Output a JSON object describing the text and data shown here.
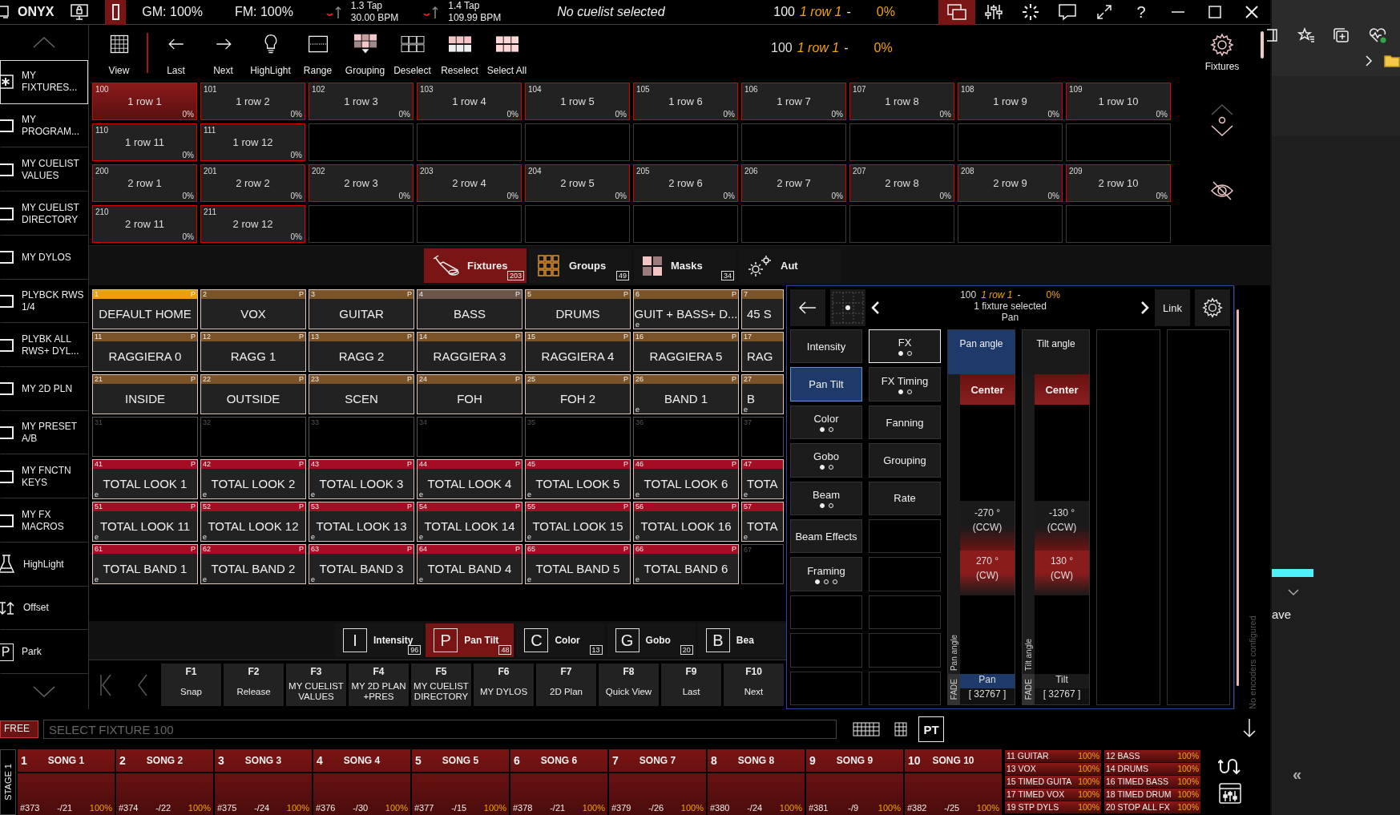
{
  "topbar": {
    "brand": "ONYX",
    "gm": "GM: 100%",
    "fm": "FM: 100%",
    "taps": [
      {
        "label": "1.3 Tap",
        "bpm": "30.00 BPM"
      },
      {
        "label": "1.4 Tap",
        "bpm": "109.99 BPM"
      }
    ],
    "cuelist": "No cuelist selected",
    "status": {
      "number": "100",
      "name": "1 row 1",
      "dash": "-",
      "percent": "0%"
    },
    "tools": [
      {
        "kind": "windows",
        "selected": true
      },
      {
        "kind": "faders",
        "selected": false
      },
      {
        "kind": "spinner",
        "selected": false
      },
      {
        "kind": "chat",
        "selected": false
      },
      {
        "kind": "expand",
        "selected": false
      }
    ],
    "help": "?"
  },
  "sidebar": [
    {
      "kind": "star",
      "label": "MY FIXTURES...",
      "selected": true
    },
    {
      "kind": "page",
      "label": "MY PROGRAM...",
      "selected": false
    },
    {
      "kind": "page",
      "label": "MY CUELIST VALUES",
      "selected": false
    },
    {
      "kind": "page",
      "label": "MY CUELIST DIRECTORY",
      "selected": false
    },
    {
      "kind": "page",
      "label": "MY DYLOS",
      "selected": false
    },
    {
      "kind": "page",
      "label": "PLYBCK RWS 1/4",
      "selected": false
    },
    {
      "kind": "page",
      "label": "PLYBK ALL RWS+ DYL...",
      "selected": false
    },
    {
      "kind": "page",
      "label": "MY 2D PLN",
      "selected": false
    },
    {
      "kind": "page",
      "label": "MY PRESET A/B",
      "selected": false
    },
    {
      "kind": "page",
      "label": "MY FNCTN KEYS",
      "selected": false
    },
    {
      "kind": "page",
      "label": "MY FX MACROS",
      "selected": false
    },
    {
      "kind": "highlight",
      "label": "HighLight",
      "selected": false
    },
    {
      "kind": "offset",
      "label": "Offset",
      "selected": false
    },
    {
      "kind": "park",
      "letter": "P",
      "label": "Park",
      "selected": false
    }
  ],
  "toolbar": [
    {
      "kind": "view",
      "label": "View"
    },
    {
      "kind": "last",
      "label": "Last"
    },
    {
      "kind": "next",
      "label": "Next"
    },
    {
      "kind": "highlight",
      "label": "HighLight"
    },
    {
      "kind": "range",
      "label": "Range"
    },
    {
      "kind": "grouping",
      "label": "Grouping"
    },
    {
      "kind": "deselect",
      "label": "Deselect"
    },
    {
      "kind": "reselect",
      "label": "Reselect"
    },
    {
      "kind": "select_all",
      "label": "Select All"
    }
  ],
  "selection_status": {
    "number": "100",
    "name": "1 row 1",
    "dash": "-",
    "percent": "0%"
  },
  "fixtures_panel": {
    "label": "Fixtures"
  },
  "fixtures": [
    {
      "kind": "fixture",
      "number": "100",
      "name": "1 row 1",
      "percent": "0%",
      "selected": true
    },
    {
      "kind": "fixture",
      "number": "101",
      "name": "1 row 2",
      "percent": "0%",
      "selected": false
    },
    {
      "kind": "fixture",
      "number": "102",
      "name": "1 row 3",
      "percent": "0%",
      "selected": false
    },
    {
      "kind": "fixture",
      "number": "103",
      "name": "1 row 4",
      "percent": "0%",
      "selected": false
    },
    {
      "kind": "fixture",
      "number": "104",
      "name": "1 row 5",
      "percent": "0%",
      "selected": false
    },
    {
      "kind": "fixture",
      "number": "105",
      "name": "1 row 6",
      "percent": "0%",
      "selected": false
    },
    {
      "kind": "fixture",
      "number": "106",
      "name": "1 row 7",
      "percent": "0%",
      "selected": false
    },
    {
      "kind": "fixture",
      "number": "107",
      "name": "1 row 8",
      "percent": "0%",
      "selected": false
    },
    {
      "kind": "fixture",
      "number": "108",
      "name": "1 row 9",
      "percent": "0%",
      "selected": false
    },
    {
      "kind": "fixture",
      "number": "109",
      "name": "1 row 10",
      "percent": "0%",
      "selected": false
    },
    {
      "kind": "fixture",
      "number": "110",
      "name": "1 row 11",
      "percent": "0%",
      "selected": false
    },
    {
      "kind": "fixture",
      "number": "111",
      "name": "1 row 12",
      "percent": "0%",
      "selected": false
    },
    {
      "kind": "empty"
    },
    {
      "kind": "empty"
    },
    {
      "kind": "empty"
    },
    {
      "kind": "empty"
    },
    {
      "kind": "empty"
    },
    {
      "kind": "empty"
    },
    {
      "kind": "empty"
    },
    {
      "kind": "empty"
    },
    {
      "kind": "fixture",
      "number": "200",
      "name": "2 row 1",
      "percent": "0%",
      "selected": false
    },
    {
      "kind": "fixture",
      "number": "201",
      "name": "2 row 2",
      "percent": "0%",
      "selected": false
    },
    {
      "kind": "fixture",
      "number": "202",
      "name": "2 row 3",
      "percent": "0%",
      "selected": false
    },
    {
      "kind": "fixture",
      "number": "203",
      "name": "2 row 4",
      "percent": "0%",
      "selected": false
    },
    {
      "kind": "fixture",
      "number": "204",
      "name": "2 row 5",
      "percent": "0%",
      "selected": false
    },
    {
      "kind": "fixture",
      "number": "205",
      "name": "2 row 6",
      "percent": "0%",
      "selected": false
    },
    {
      "kind": "fixture",
      "number": "206",
      "name": "2 row 7",
      "percent": "0%",
      "selected": false
    },
    {
      "kind": "fixture",
      "number": "207",
      "name": "2 row 8",
      "percent": "0%",
      "selected": false
    },
    {
      "kind": "fixture",
      "number": "208",
      "name": "2 row 9",
      "percent": "0%",
      "selected": false
    },
    {
      "kind": "fixture",
      "number": "209",
      "name": "2 row 10",
      "percent": "0%",
      "selected": false
    },
    {
      "kind": "fixture",
      "number": "210",
      "name": "2 row 11",
      "percent": "0%",
      "selected": false
    },
    {
      "kind": "fixture",
      "number": "211",
      "name": "2 row 12",
      "percent": "0%",
      "selected": false
    },
    {
      "kind": "empty"
    },
    {
      "kind": "empty"
    },
    {
      "kind": "empty"
    },
    {
      "kind": "empty"
    },
    {
      "kind": "empty"
    },
    {
      "kind": "empty"
    },
    {
      "kind": "empty"
    },
    {
      "kind": "empty"
    }
  ],
  "tabs": [
    {
      "kind": "fixtures",
      "label": "Fixtures",
      "count": "203",
      "selected": true
    },
    {
      "kind": "groups",
      "label": "Groups",
      "count": "49",
      "selected": false
    },
    {
      "kind": "masks",
      "label": "Masks",
      "count": "34",
      "selected": false
    },
    {
      "kind": "auto",
      "label": "Aut",
      "selected": false
    }
  ],
  "presets": [
    {
      "kind": "preset",
      "number": "1",
      "name": "DEFAULT HOME",
      "color": "#e8a010",
      "tag": "P"
    },
    {
      "kind": "preset",
      "number": "2",
      "name": "VOX",
      "color": "#7a5428",
      "tag": "P"
    },
    {
      "kind": "preset",
      "number": "3",
      "name": "GUITAR",
      "color": "#7a5428",
      "tag": "P"
    },
    {
      "kind": "preset",
      "number": "4",
      "name": "BASS",
      "color": "#6b5548",
      "tag": "P"
    },
    {
      "kind": "preset",
      "number": "5",
      "name": "DRUMS",
      "color": "#7a5428",
      "tag": "P"
    },
    {
      "kind": "preset",
      "number": "6",
      "name": "GUIT + BASS+ D...",
      "color": "#7a5428",
      "tag": "P",
      "flag": "e"
    },
    {
      "kind": "preset",
      "number": "7",
      "name": "45 S",
      "color": "#7a5428"
    },
    {
      "kind": "preset",
      "number": "11",
      "name": "RAGGIERA 0",
      "color": "#7a5428",
      "tag": "P"
    },
    {
      "kind": "preset",
      "number": "12",
      "name": "RAGG 1",
      "color": "#7a5428",
      "tag": "P"
    },
    {
      "kind": "preset",
      "number": "13",
      "name": "RAGG 2",
      "color": "#7a5428",
      "tag": "P"
    },
    {
      "kind": "preset",
      "number": "14",
      "name": "RAGGIERA 3",
      "color": "#7a5428",
      "tag": "P"
    },
    {
      "kind": "preset",
      "number": "15",
      "name": "RAGGIERA 4",
      "color": "#7a5428",
      "tag": "P"
    },
    {
      "kind": "preset",
      "number": "16",
      "name": "RAGGIERA 5",
      "color": "#7a5428",
      "tag": "P"
    },
    {
      "kind": "preset",
      "number": "17",
      "name": "RAG",
      "color": "#7a5428"
    },
    {
      "kind": "preset",
      "number": "21",
      "name": "INSIDE",
      "color": "#7a5428",
      "tag": "P"
    },
    {
      "kind": "preset",
      "number": "22",
      "name": "OUTSIDE",
      "color": "#7a5428",
      "tag": "P"
    },
    {
      "kind": "preset",
      "number": "23",
      "name": "SCEN",
      "color": "#7a5428",
      "tag": "P"
    },
    {
      "kind": "preset",
      "number": "24",
      "name": "FOH",
      "color": "#7a5428",
      "tag": "P"
    },
    {
      "kind": "preset",
      "number": "25",
      "name": "FOH 2",
      "color": "#7a5428",
      "tag": "P"
    },
    {
      "kind": "preset",
      "number": "26",
      "name": "BAND 1",
      "color": "#7a5428",
      "tag": "P",
      "flag": "e"
    },
    {
      "kind": "preset",
      "number": "27",
      "name": "B",
      "color": "#7a5428",
      "flag": "e"
    },
    {
      "kind": "empty",
      "number": "31"
    },
    {
      "kind": "empty",
      "number": "32"
    },
    {
      "kind": "empty",
      "number": "33"
    },
    {
      "kind": "empty",
      "number": "34"
    },
    {
      "kind": "empty",
      "number": "35"
    },
    {
      "kind": "empty",
      "number": "36"
    },
    {
      "kind": "empty",
      "number": "37"
    },
    {
      "kind": "preset",
      "number": "41",
      "name": "TOTAL LOOK 1",
      "color": "#a50d25",
      "tag": "P",
      "flag": "e"
    },
    {
      "kind": "preset",
      "number": "42",
      "name": "TOTAL LOOK 2",
      "color": "#a50d25",
      "tag": "P",
      "flag": "e"
    },
    {
      "kind": "preset",
      "number": "43",
      "name": "TOTAL LOOK 3",
      "color": "#a50d25",
      "tag": "P",
      "flag": "e"
    },
    {
      "kind": "preset",
      "number": "44",
      "name": "TOTAL LOOK 4",
      "color": "#a50d25",
      "tag": "P",
      "flag": "e"
    },
    {
      "kind": "preset",
      "number": "45",
      "name": "TOTAL LOOK 5",
      "color": "#a50d25",
      "tag": "P",
      "flag": "e"
    },
    {
      "kind": "preset",
      "number": "46",
      "name": "TOTAL LOOK 6",
      "color": "#a50d25",
      "tag": "P",
      "flag": "e"
    },
    {
      "kind": "preset",
      "number": "47",
      "name": "TOTA",
      "color": "#a50d25",
      "flag": "e"
    },
    {
      "kind": "preset",
      "number": "51",
      "name": "TOTAL LOOK 11",
      "color": "#a50d25",
      "tag": "P",
      "flag": "e"
    },
    {
      "kind": "preset",
      "number": "52",
      "name": "TOTAL LOOK 12",
      "color": "#a50d25",
      "tag": "P",
      "flag": "e"
    },
    {
      "kind": "preset",
      "number": "53",
      "name": "TOTAL LOOK 13",
      "color": "#a50d25",
      "tag": "P",
      "flag": "e"
    },
    {
      "kind": "preset",
      "number": "54",
      "name": "TOTAL LOOK 14",
      "color": "#a50d25",
      "tag": "P",
      "flag": "e"
    },
    {
      "kind": "preset",
      "number": "55",
      "name": "TOTAL LOOK 15",
      "color": "#a50d25",
      "tag": "P",
      "flag": "e"
    },
    {
      "kind": "preset",
      "number": "56",
      "name": "TOTAL LOOK 16",
      "color": "#a50d25",
      "tag": "P",
      "flag": "e"
    },
    {
      "kind": "preset",
      "number": "57",
      "name": "TOTA",
      "color": "#a50d25",
      "flag": "e"
    },
    {
      "kind": "preset",
      "number": "61",
      "name": "TOTAL BAND 1",
      "color": "#a50d25",
      "tag": "P",
      "flag": "e"
    },
    {
      "kind": "preset",
      "number": "62",
      "name": "TOTAL BAND 2",
      "color": "#a50d25",
      "tag": "P",
      "flag": "e"
    },
    {
      "kind": "preset",
      "number": "63",
      "name": "TOTAL BAND 3",
      "color": "#a50d25",
      "tag": "P",
      "flag": "e"
    },
    {
      "kind": "preset",
      "number": "64",
      "name": "TOTAL BAND 4",
      "color": "#a50d25",
      "tag": "P",
      "flag": "e"
    },
    {
      "kind": "preset",
      "number": "65",
      "name": "TOTAL BAND 5",
      "color": "#a50d25",
      "tag": "P",
      "flag": "e"
    },
    {
      "kind": "preset",
      "number": "66",
      "name": "TOTAL BAND 6",
      "color": "#a50d25",
      "tag": "P",
      "flag": "e"
    },
    {
      "kind": "empty",
      "number": "67"
    }
  ],
  "feature_tabs": [
    {
      "letter": "I",
      "label": "Intensity",
      "count": "96",
      "selected": false
    },
    {
      "letter": "P",
      "label": "Pan Tilt",
      "count": "48",
      "selected": true
    },
    {
      "letter": "C",
      "label": "Color",
      "count": "13",
      "selected": false
    },
    {
      "letter": "G",
      "label": "Gobo",
      "count": "20",
      "selected": false
    },
    {
      "letter": "B",
      "label": "Bea",
      "selected": false
    }
  ],
  "function_keys": [
    {
      "key": "F1",
      "label": "Snap"
    },
    {
      "key": "F2",
      "label": "Release"
    },
    {
      "key": "F3",
      "label": "MY CUELIST VALUES"
    },
    {
      "key": "F4",
      "label": "MY 2D PLAN +PRES"
    },
    {
      "key": "F5",
      "label": "MY CUELIST DIRECTORY"
    },
    {
      "key": "F6",
      "label": "MY DYLOS"
    },
    {
      "key": "F7",
      "label": "2D Plan"
    },
    {
      "key": "F8",
      "label": "Quick View"
    },
    {
      "key": "F9",
      "label": "Last"
    },
    {
      "key": "F10",
      "label": "Next"
    }
  ],
  "programmer": {
    "status": {
      "number": "100",
      "name": "1 row 1",
      "dash": "-",
      "percent": "0%"
    },
    "selection": "1 fixture selected",
    "parameter": "Pan",
    "link": "Link",
    "groups": [
      {
        "kind": "button",
        "label": "Intensity",
        "selected": false,
        "focused": false
      },
      {
        "kind": "button",
        "label": "Pan Tilt",
        "selected": true,
        "focused": false
      },
      {
        "kind": "button",
        "label": "Color",
        "selected": false,
        "focused": false,
        "dots": [
          {
            "selected": true
          },
          {
            "selected": false
          }
        ]
      },
      {
        "kind": "button",
        "label": "Gobo",
        "selected": false,
        "focused": false,
        "dots": [
          {
            "selected": true
          },
          {
            "selected": false
          }
        ]
      },
      {
        "kind": "button",
        "label": "Beam",
        "selected": false,
        "focused": false,
        "dots": [
          {
            "selected": true
          },
          {
            "selected": false
          }
        ]
      },
      {
        "kind": "button",
        "label": "Beam Effects",
        "selected": false,
        "focused": false
      },
      {
        "kind": "button",
        "label": "Framing",
        "selected": false,
        "focused": false,
        "dots": [
          {
            "selected": true
          },
          {
            "selected": false
          },
          {
            "selected": false
          }
        ]
      },
      {
        "kind": "empty"
      },
      {
        "kind": "empty"
      },
      {
        "kind": "empty"
      }
    ],
    "functions": [
      {
        "kind": "button",
        "label": "FX",
        "selected": false,
        "focused": true,
        "dots": [
          {
            "selected": true
          },
          {
            "selected": false
          }
        ]
      },
      {
        "kind": "button",
        "label": "FX Timing",
        "selected": false,
        "focused": false,
        "dots": [
          {
            "selected": true
          },
          {
            "selected": false
          }
        ]
      },
      {
        "kind": "button",
        "label": "Fanning",
        "selected": false,
        "focused": false
      },
      {
        "kind": "button",
        "label": "Grouping",
        "selected": false,
        "focused": false
      },
      {
        "kind": "button",
        "label": "Rate",
        "selected": false,
        "focused": false
      },
      {
        "kind": "empty"
      },
      {
        "kind": "empty"
      },
      {
        "kind": "empty"
      },
      {
        "kind": "empty"
      },
      {
        "kind": "empty"
      }
    ],
    "encoders": [
      {
        "kind": "encoder",
        "label": "Pan angle",
        "selected": true,
        "strip": "Pan angle",
        "center": "Center",
        "min": "-270 °",
        "min_dir": "(CCW)",
        "max": "270 °",
        "max_dir": "(CW)",
        "fade": "FADE",
        "name": "Pan",
        "value": "[ 32767 ]"
      },
      {
        "kind": "encoder",
        "label": "Tilt angle",
        "selected": false,
        "strip": "Tilt angle",
        "center": "Center",
        "min": "-130 °",
        "min_dir": "(CCW)",
        "max": "130 °",
        "max_dir": "(CW)",
        "fade": "FADE",
        "name": "Tilt",
        "value": "[ 32767 ]"
      },
      {
        "kind": "empty"
      },
      {
        "kind": "empty"
      }
    ],
    "hint": "No encoders configured"
  },
  "command_line": {
    "mode": "FREE",
    "placeholder": "SELECT FIXTURE 100",
    "pt": "PT"
  },
  "stage": "STAGE 1",
  "playbacks": [
    {
      "number": "1",
      "name": "SONG 1",
      "cue": "#373",
      "step": "-/21",
      "level": "100%"
    },
    {
      "number": "2",
      "name": "SONG 2",
      "cue": "#374",
      "step": "-/22",
      "level": "100%"
    },
    {
      "number": "3",
      "name": "SONG 3",
      "cue": "#375",
      "step": "-/24",
      "level": "100%"
    },
    {
      "number": "4",
      "name": "SONG 4",
      "cue": "#376",
      "step": "-/30",
      "level": "100%"
    },
    {
      "number": "5",
      "name": "SONG 5",
      "cue": "#377",
      "step": "-/15",
      "level": "100%"
    },
    {
      "number": "6",
      "name": "SONG 6",
      "cue": "#378",
      "step": "-/21",
      "level": "100%"
    },
    {
      "number": "7",
      "name": "SONG 7",
      "cue": "#379",
      "step": "-/26",
      "level": "100%"
    },
    {
      "number": "8",
      "name": "SONG 8",
      "cue": "#380",
      "step": "-/24",
      "level": "100%"
    },
    {
      "number": "9",
      "name": "SONG 9",
      "cue": "#381",
      "step": "-/9",
      "level": "100%"
    },
    {
      "number": "10",
      "name": "SONG 10",
      "cue": "#382",
      "step": "-/25",
      "level": "100%"
    }
  ],
  "mini_playbacks": [
    {
      "label": "11 GUITAR",
      "level": "100%"
    },
    {
      "label": "12 BASS",
      "level": "100%"
    },
    {
      "label": "13 VOX",
      "level": "100%"
    },
    {
      "label": "14 DRUMS",
      "level": "100%"
    },
    {
      "label": "15 TIMED GUITA",
      "level": "100%"
    },
    {
      "label": "16 TIMED BASS",
      "level": "100%"
    },
    {
      "label": "17 TIMED VOX",
      "level": "100%"
    },
    {
      "label": "18 TIMED DRUM",
      "level": "100%"
    },
    {
      "label": "19 STP DYLS",
      "level": "100%"
    },
    {
      "label": "20 STOP ALL FX",
      "level": "100%"
    }
  ],
  "browser": {
    "fragment": "ave",
    "collapse": "«"
  }
}
